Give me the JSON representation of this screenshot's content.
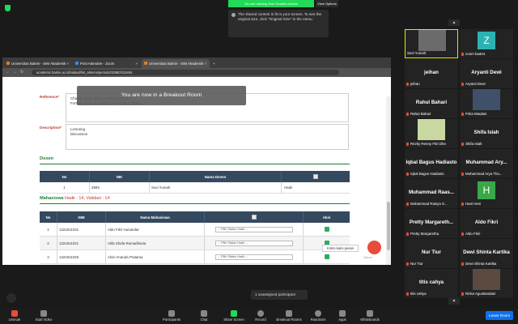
{
  "banner": {
    "viewing": "You are viewing Susi Yunarti's screen",
    "view_options": "View Options"
  },
  "tooltip": "The shared content is fit to your screen. To see the original size, click \"Original Size\" in the menu.",
  "browser": {
    "tabs": [
      {
        "label": "Universitas Bakrie - SIM Akademik",
        "color": "#e67e22"
      },
      {
        "label": "Post Attendee - Zoom",
        "color": "#2d8cff"
      },
      {
        "label": "Universitas Bakrie - SIM Akademik",
        "color": "#e67e22"
      }
    ],
    "url": "academic.bakrie.ac.id/siakad/list_absensiperiode/32960/115494"
  },
  "form": {
    "reference_label": "Reference*",
    "reference_lines": [
      "Charley, Steve May, & Munshi (2021)",
      "Forthler, R. S., & Fackler, P. H. (Eds.). (2021)."
    ],
    "description_label": "Description*",
    "description_lines": [
      "Lecturing",
      "Discussion"
    ]
  },
  "dosen": {
    "title": "Dosen",
    "headers": [
      "No",
      "NIK",
      "Nama Dosen",
      ""
    ],
    "row": [
      "1",
      "2593",
      "Susi Yunarti",
      "Hadir"
    ]
  },
  "mahasiswa": {
    "title": "Mahasiswa",
    "hadir": "Hadir : 14",
    "validasi": ", Validasi : 14",
    "headers": [
      "No",
      "NIM",
      "Nama Mahasiswa",
      "",
      "Aksi"
    ],
    "select_placeholder": "-- Pilih Status Hadir --",
    "rows": [
      [
        "1",
        "1221911031",
        "Aldo Fikri Hunandar"
      ],
      [
        "2",
        "1221911021",
        "Alifa Shafa Ramadhania"
      ],
      [
        "3",
        "1221911026",
        "Alvin Ananda Pratama"
      ]
    ]
  },
  "breakout_notice": "You are now in a Breakout Room",
  "chat_tip": "Kirimi kami pesan",
  "chat_brand": "Qiscus",
  "gallery": [
    {
      "name": "Susi Yunarti",
      "type": "photo",
      "color": "#6b6b6b",
      "highlight": true
    },
    {
      "name": "zoom baa04",
      "type": "letter",
      "letter": "Z",
      "color": "#2bb3b3"
    },
    {
      "name": "jeihan",
      "big": "jeihan"
    },
    {
      "name": "Aryanti Dewi",
      "big": "Aryanti Dewi"
    },
    {
      "name": "Rahul Bahari",
      "big": "Rahul Bahari"
    },
    {
      "name": "Fitria Maulani",
      "type": "photo",
      "color": "#40506a"
    },
    {
      "name": "Rezky Renny Fitri Dhe",
      "type": "photo",
      "color": "#c8d8a0"
    },
    {
      "name": "Shifa Islah",
      "big": "Shifa Islah"
    },
    {
      "name": "Iqbal Bagus Hadiasto",
      "big": "Iqbal Bagus Hadiasto"
    },
    {
      "name": "Muhammad Arya Tho...",
      "big": "Muhammad Ary..."
    },
    {
      "name": "Muhammad Rasiya S...",
      "big": "Muhammad Raas..."
    },
    {
      "name": "Hani Heni",
      "type": "letter",
      "letter": "H",
      "color": "#3aa848"
    },
    {
      "name": "Pretty Margaretha",
      "big": "Pretty Margareth..."
    },
    {
      "name": "Aldo Fikri",
      "big": "Aldo Fikri"
    },
    {
      "name": "Nur Tiur",
      "big": "Nur Tiur"
    },
    {
      "name": "Dewi Shinta Kartika",
      "big": "Dewi Shinta Kartika"
    },
    {
      "name": "titis cahya",
      "big": "titis cahya"
    },
    {
      "name": "Rizka Agustiandani",
      "type": "photo",
      "color": "#5a4a40"
    }
  ],
  "gallery_nav": {
    "prev": "▲",
    "next": "▼"
  },
  "unassigned": "1 unassigned participant",
  "toolbar": {
    "left": [
      {
        "label": "Unmute",
        "icon": "mic-muted-icon"
      },
      {
        "label": "Start Video",
        "icon": "video-off-icon"
      }
    ],
    "center": [
      {
        "label": "Participants",
        "icon": "participants-icon",
        "count": "21"
      },
      {
        "label": "Chat",
        "icon": "chat-icon"
      },
      {
        "label": "Share Screen",
        "icon": "share-screen-icon"
      },
      {
        "label": "Record",
        "icon": "record-icon"
      },
      {
        "label": "Breakout Rooms",
        "icon": "breakout-icon"
      },
      {
        "label": "Reactions",
        "icon": "reactions-icon"
      },
      {
        "label": "Apps",
        "icon": "apps-icon"
      },
      {
        "label": "Whiteboards",
        "icon": "whiteboard-icon"
      }
    ],
    "leave": "Leave Room"
  }
}
